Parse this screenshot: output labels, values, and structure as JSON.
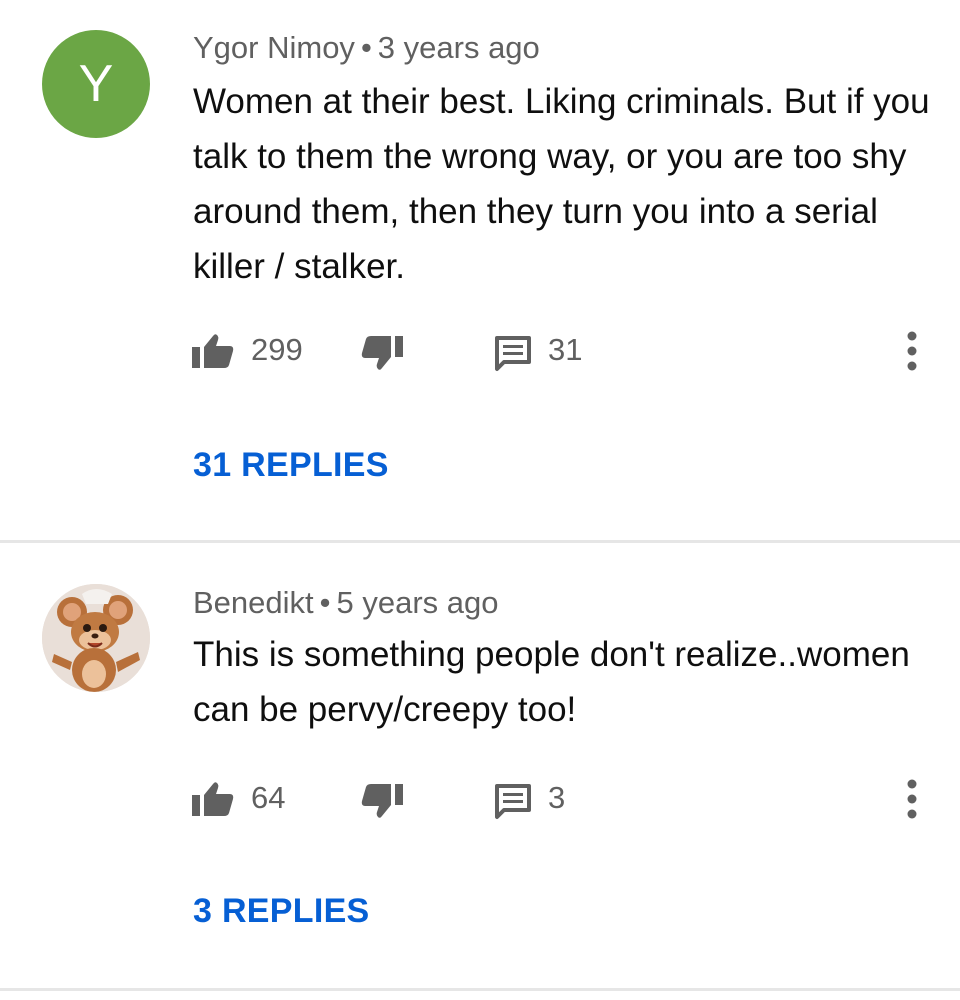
{
  "comments": [
    {
      "avatar_letter": "Y",
      "author": "Ygor Nimoy",
      "separator": "•",
      "time": "3 years ago",
      "text": "Women at their best. Liking criminals. But if you talk to them the wrong way, or you are too shy around them, then they turn you into a serial killer / stalker.",
      "likes": "299",
      "reply_count": "31",
      "replies_label": "31 REPLIES",
      "avatar_color": "#6ba645"
    },
    {
      "avatar_letter": "",
      "author": "Benedikt",
      "separator": "•",
      "time": "5 years ago",
      "text": "This is something people don't realize..women can be pervy/creepy too!",
      "likes": "64",
      "reply_count": "3",
      "replies_label": "3 REPLIES",
      "avatar_color": "#e9dfd8"
    }
  ],
  "colors": {
    "link": "#065fd4",
    "meta_text": "#606060",
    "body_text": "#0f0f0f",
    "icon": "#606060"
  },
  "icons": {
    "like": "thumb-up-icon",
    "dislike": "thumb-down-icon",
    "reply": "comment-icon",
    "more": "more-vertical-icon"
  }
}
